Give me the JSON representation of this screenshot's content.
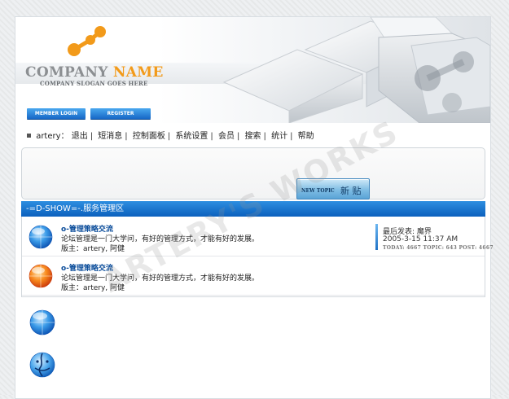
{
  "header": {
    "company_name_first": "COMPANY",
    "company_name_second": "NAME",
    "slogan": "COMPANY SLOGAN GOES HERE",
    "member_login_label": "MEMBER LOGIN",
    "register_label": "REGISTER"
  },
  "nav": {
    "username": "artery",
    "colon": "：",
    "items": [
      "退出",
      "短消息",
      "控制面板",
      "系统设置",
      "会员",
      "搜索",
      "统计",
      "帮助"
    ]
  },
  "new_topic": {
    "label_en": "NEW TOPIC",
    "label_cn": "新 贴"
  },
  "section": {
    "title": "-=D-SHOW=-.服务管理区",
    "forums": [
      {
        "title": "o-管理策略交流",
        "description": "论坛管理是一门大学问，有好的管理方式，才能有好的发展。",
        "moderators": "版主：artery, 阿健",
        "last_post_label": "最后发表: 魔界",
        "last_post_date": "2005-3-15 11:37 AM",
        "stats": "TODAY: 4667 TOPIC: 643 POST: 4667",
        "icon": "blue-orb-icon"
      },
      {
        "title": "o-管理策略交流",
        "description": "论坛管理是一门大学问，有好的管理方式，才能有好的发展。",
        "moderators": "版主：artery, 阿健",
        "icon": "orange-orb-icon"
      }
    ]
  },
  "legend": [
    "blue-orb-icon",
    "finder-face-icon"
  ],
  "watermark": "ARTERY'S WORKS",
  "colors": {
    "accent_blue": "#0b60bd",
    "brand_orange": "#f29a1a",
    "link_blue": "#0a4c9a"
  }
}
